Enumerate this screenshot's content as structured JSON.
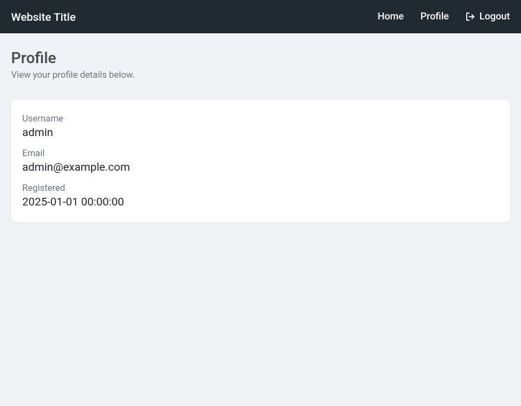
{
  "navbar": {
    "brand": "Website Title",
    "links": {
      "home": "Home",
      "profile": "Profile",
      "logout": "Logout"
    }
  },
  "page": {
    "title": "Profile",
    "subtitle": "View your profile details below."
  },
  "profile": {
    "username_label": "Username",
    "username_value": "admin",
    "email_label": "Email",
    "email_value": "admin@example.com",
    "registered_label": "Registered",
    "registered_value": "2025-01-01 00:00:00"
  }
}
